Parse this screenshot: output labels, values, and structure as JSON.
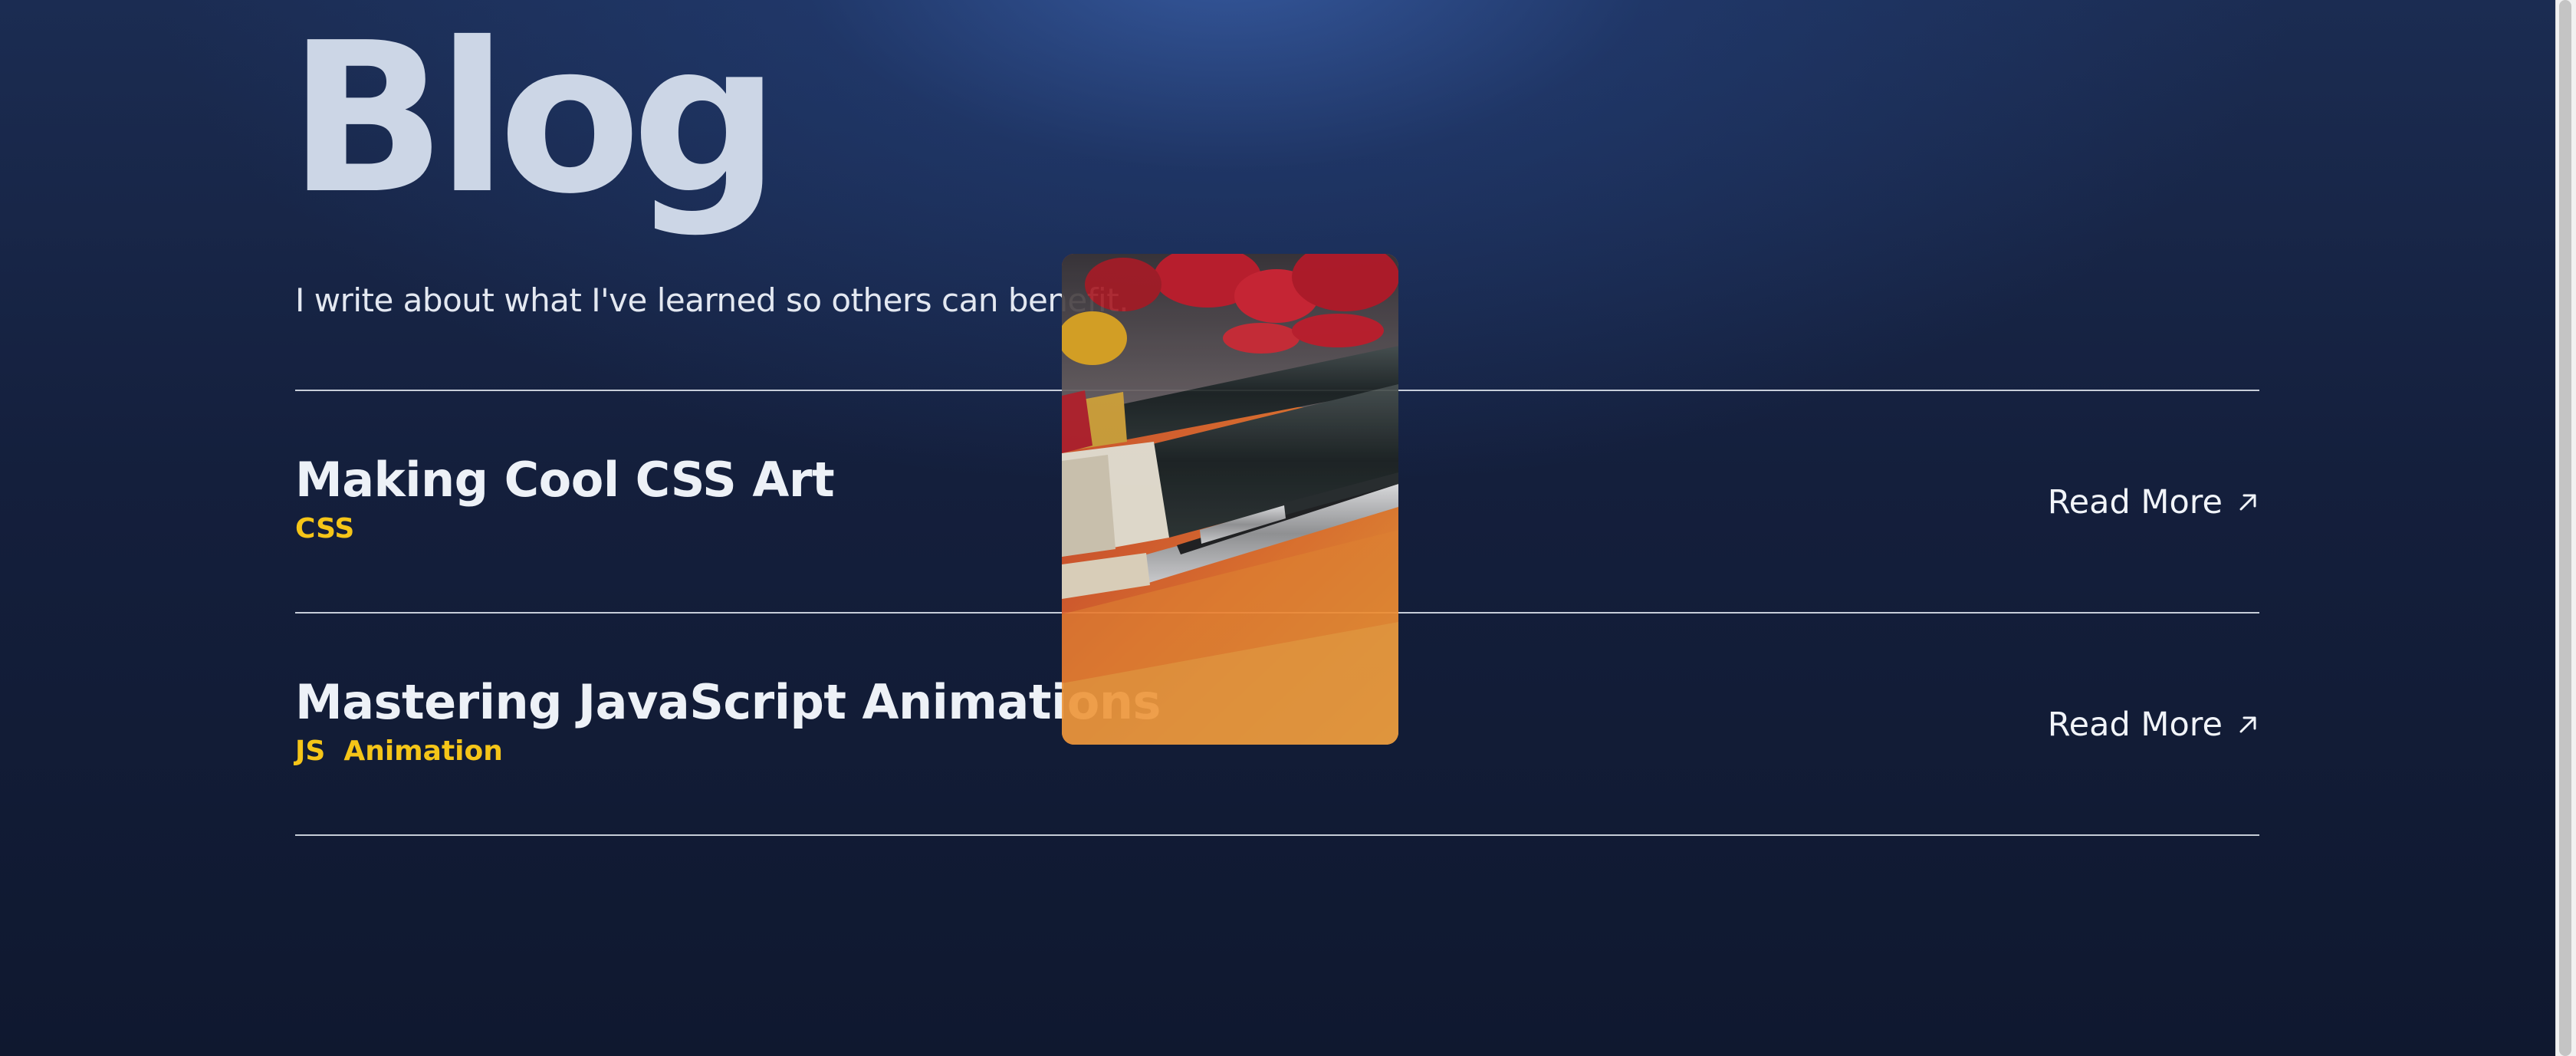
{
  "page": {
    "title": "Blog",
    "subtitle": "I write about what I've learned so others can benefit."
  },
  "posts": [
    {
      "title": "Making Cool CSS Art",
      "tags": [
        "CSS"
      ],
      "read_more_label": "Read More"
    },
    {
      "title": "Mastering JavaScript Animations",
      "tags": [
        "JS",
        "Animation"
      ],
      "read_more_label": "Read More"
    }
  ],
  "preview_image": {
    "subject": "paint brushes on orange paint"
  },
  "colors": {
    "background": "#141f3c",
    "accent_tag": "#f5c518",
    "title": "#ccd6e6",
    "text": "#e9edf5"
  }
}
